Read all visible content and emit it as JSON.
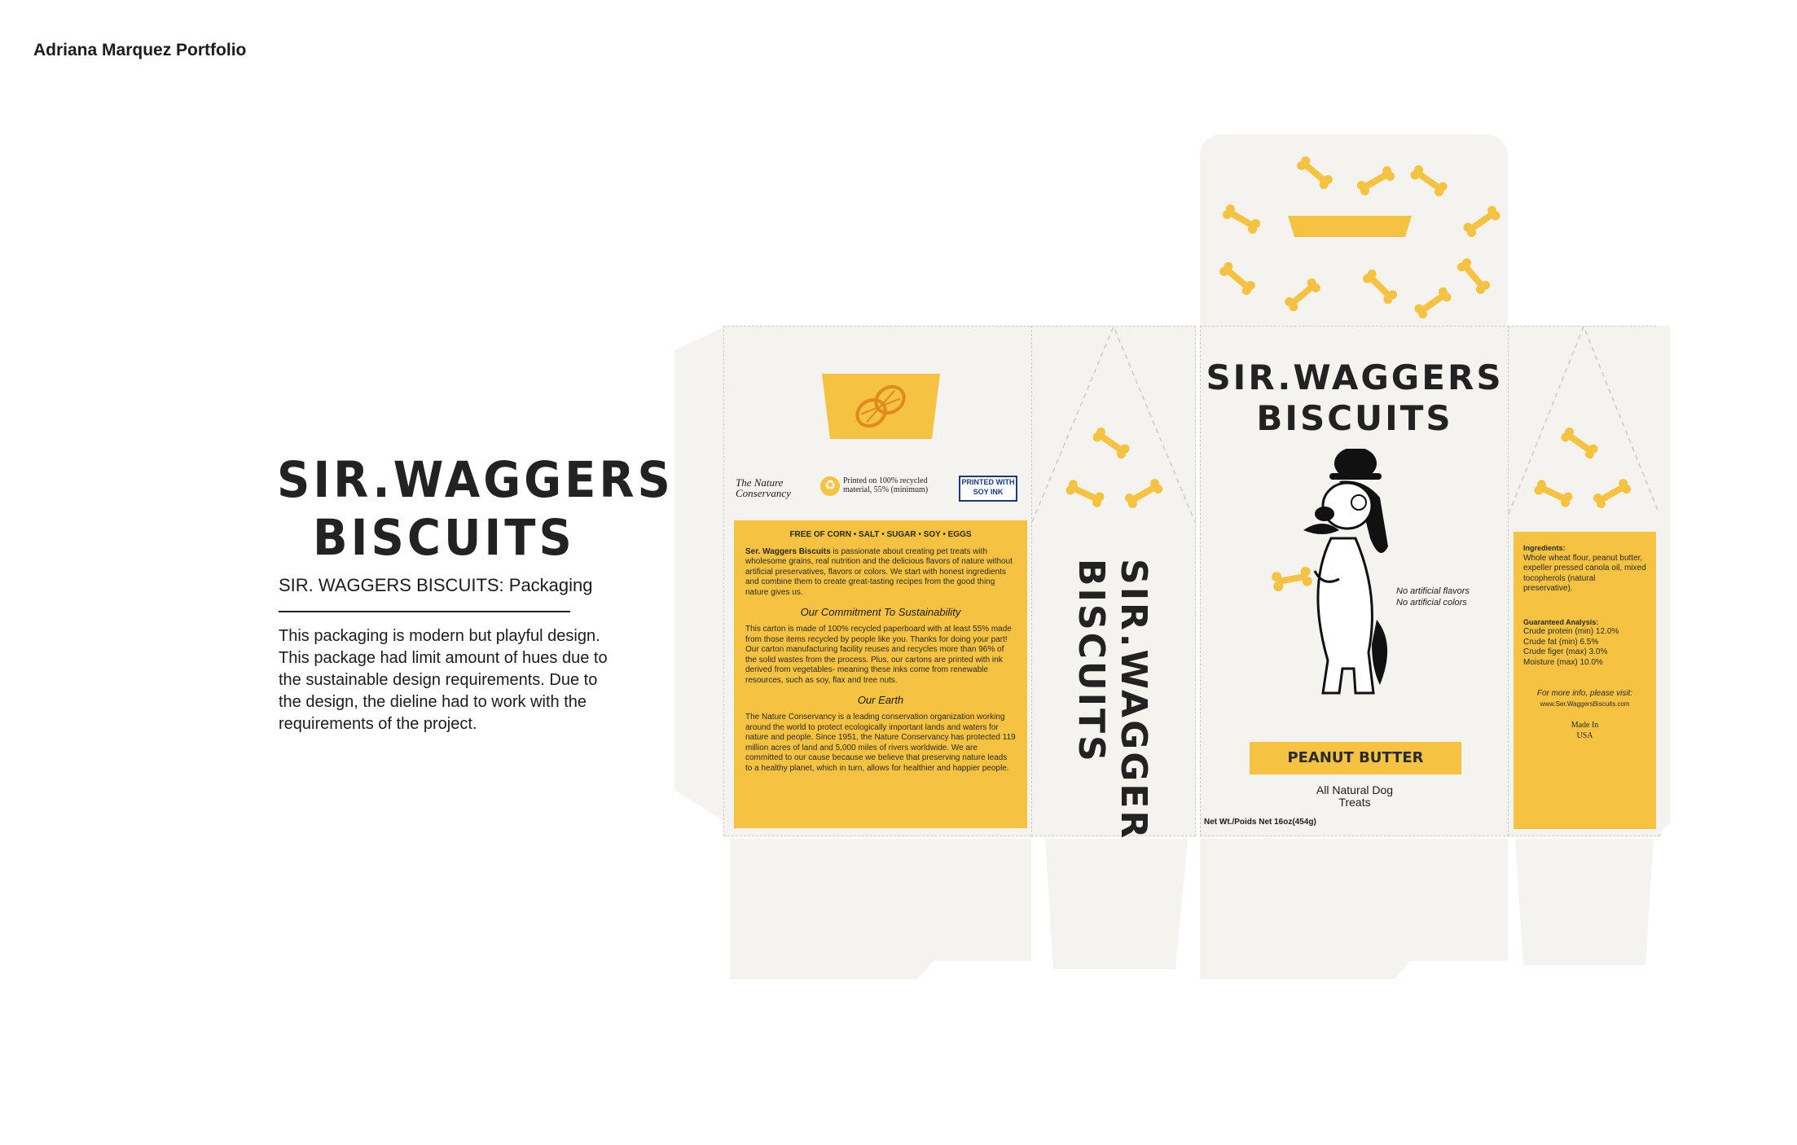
{
  "header": {
    "portfolio": "Adriana Marquez Portfolio"
  },
  "brand": {
    "line1": "SIR.WAGGERS",
    "line2": "BISCUITS"
  },
  "project": {
    "subtitle": "SIR. WAGGERS BISCUITS: Packaging",
    "description": "This packaging is modern but playful design. This package had limit amount of hues due to the sustainable design requirements. Due to the design, the dieline had to work with the requirements of the project."
  },
  "back_panel": {
    "logo_nature": "The Nature Conservancy",
    "recycled_text": "Printed on 100% recycled material, 55% (minimum)",
    "soy_text": "PRINTED WITH SOY INK",
    "free_of": "FREE OF CORN • SALT • SUGAR • SOY • EGGS",
    "intro_brand": "Ser. Waggers Biscuits",
    "intro": "is passionate about creating pet treats with wholesome grains, real nutrition and the delicious flavors of nature without artificial preservatives, flavors or colors. We start with honest ingredients and combine them to create great-tasting recipes from the good thing nature gives us.",
    "heading_sustain": "Our Commitment To Sustainability",
    "sustain": "This carton is made of 100% recycled paperboard with at least 55% made from those items recycled by people like you. Thanks for doing your part! Our carton manufacturing facility reuses and recycles more than 96% of the solid wastes from the process. Plus, our cartons are printed with ink derived from vegetables- meaning these inks come from renewable resources, such as soy, flax and tree nuts.",
    "heading_earth": "Our Earth",
    "earth": "The Nature Conservancy is a leading conservation organization working around the world to protect ecologically important lands and waters for nature and people. Since 1951, the Nature Conservancy has protected 119 million acres of land and 5,000 miles of rivers worldwide. We are committed to our cause because we believe that preserving nature leads to a healthy planet, which in turn, allows for healthier and happier people."
  },
  "side_panel": {
    "title1": "SIR.WAGGERS",
    "title2": "BISCUITS"
  },
  "front_panel": {
    "title1": "SIR.WAGGERS",
    "title2": "BISCUITS",
    "no_flavors": "No artificial flavors",
    "no_colors": "No artificial colors",
    "flavor": "PEANUT BUTTER",
    "tagline1": "All Natural Dog",
    "tagline2": "Treats",
    "net_wt": "Net Wt./Poids Net 16oz(454g)"
  },
  "right_panel": {
    "ingredients_label": "Ingredients:",
    "ingredients": "Whole wheat flour, peanut butter, expeller pressed canola oil, mixed tocopherols (natural preservative).",
    "analysis_label": "Guaranteed Analysis:",
    "analysis": [
      "Crude protein (min) 12.0%",
      "Crude fat (min) 6.5%",
      "Crude figer (max) 3.0%",
      "Moisture (max) 10.0%"
    ],
    "more_info": "For more info, please visit:",
    "url": "www.Ser.WaggersBiscuits.com",
    "made_in1": "Made In",
    "made_in2": "USA"
  },
  "colors": {
    "accent": "#f5c242",
    "panel": "#f5f3ef",
    "ink": "#222222"
  }
}
